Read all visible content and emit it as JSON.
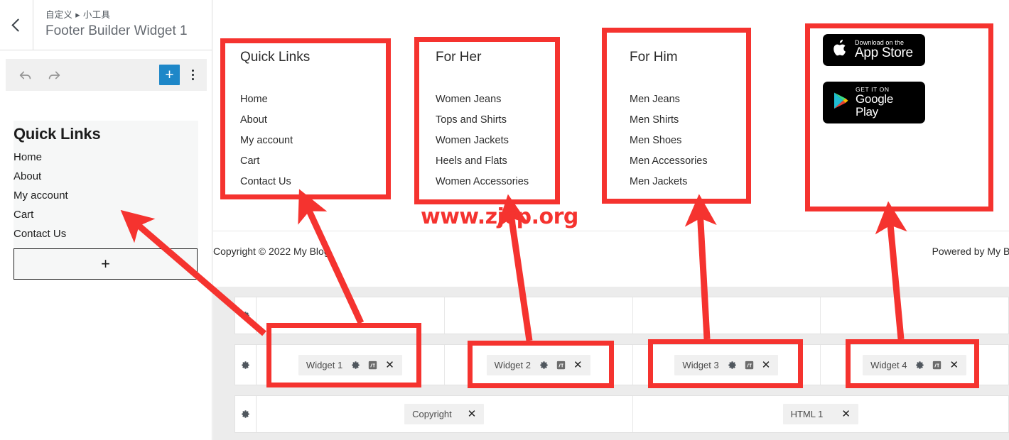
{
  "sidebar": {
    "back_icon": "chevron-left-icon",
    "breadcrumb": "自定义 ▸ 小工具",
    "panel_title": "Footer Builder Widget 1",
    "toolbar": {
      "undo_label": "↩",
      "redo_label": "↪",
      "add_block_label": "+"
    },
    "block": {
      "heading": "Quick Links",
      "items": [
        "Home",
        "About",
        "My account",
        "Cart",
        "Contact Us"
      ]
    },
    "appender_label": "+"
  },
  "preview": {
    "columns": [
      {
        "id": "quick",
        "heading": "Quick Links",
        "items": [
          "Home",
          "About",
          "My account",
          "Cart",
          "Contact Us"
        ]
      },
      {
        "id": "her",
        "heading": "For Her",
        "items": [
          "Women Jeans",
          "Tops and Shirts",
          "Women Jackets",
          "Heels and Flats",
          "Women Accessories"
        ]
      },
      {
        "id": "him",
        "heading": "For Him",
        "items": [
          "Men Jeans",
          "Men Shirts",
          "Men Shoes",
          "Men Accessories",
          "Men Jackets"
        ]
      }
    ],
    "badges": {
      "app_store": {
        "small": "Download on the",
        "big": "App Store",
        "icon": "apple-icon"
      },
      "google_play": {
        "small": "GET IT ON",
        "big": "Google Play",
        "icon": "google-play-icon"
      }
    },
    "copyright": "Copyright © 2022 My Blog",
    "powered_by": "Powered by My Blog"
  },
  "builder": {
    "row_gear_icon": "gear-icon",
    "rows": [
      {
        "cells": [
          {},
          {},
          {},
          {}
        ]
      },
      {
        "cells": [
          {
            "chip": {
              "label": "Widget 1",
              "icons": [
                "gear-icon",
                "duplicate-icon",
                "close-icon"
              ]
            }
          },
          {
            "chip": {
              "label": "Widget 2",
              "icons": [
                "gear-icon",
                "duplicate-icon",
                "close-icon"
              ]
            }
          },
          {
            "chip": {
              "label": "Widget 3",
              "icons": [
                "gear-icon",
                "duplicate-icon",
                "close-icon"
              ]
            }
          },
          {
            "chip": {
              "label": "Widget 4",
              "icons": [
                "gear-icon",
                "duplicate-icon",
                "close-icon"
              ]
            }
          }
        ]
      },
      {
        "cells": [
          {
            "chip": {
              "label": "Copyright",
              "icons": [
                "close-icon"
              ]
            }
          },
          {
            "chip": {
              "label": "HTML 1",
              "icons": [
                "close-icon"
              ]
            }
          }
        ]
      }
    ]
  },
  "annotation": {
    "color": "#f5332f",
    "watermark": "www.zjcp.org"
  }
}
